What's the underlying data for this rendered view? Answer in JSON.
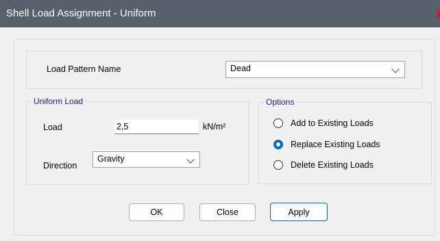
{
  "window": {
    "title": "Shell Load Assignment - Uniform"
  },
  "load_pattern": {
    "label": "Load Pattern Name",
    "selected": "Dead"
  },
  "uniform_load": {
    "legend": "Uniform Load",
    "load_label": "Load",
    "load_value": "2,5",
    "unit": "kN/m²",
    "direction_label": "Direction",
    "direction_selected": "Gravity"
  },
  "options": {
    "legend": "Options",
    "items": [
      {
        "label": "Add to Existing Loads",
        "checked": false
      },
      {
        "label": "Replace Existing Loads",
        "checked": true
      },
      {
        "label": "Delete Existing Loads",
        "checked": false
      }
    ]
  },
  "buttons": {
    "ok": "OK",
    "close": "Close",
    "apply": "Apply"
  },
  "colors": {
    "titlebar": "#56616c",
    "accent": "#0067c0",
    "legend_text": "#1a1a8c",
    "close_red": "#e81123"
  }
}
